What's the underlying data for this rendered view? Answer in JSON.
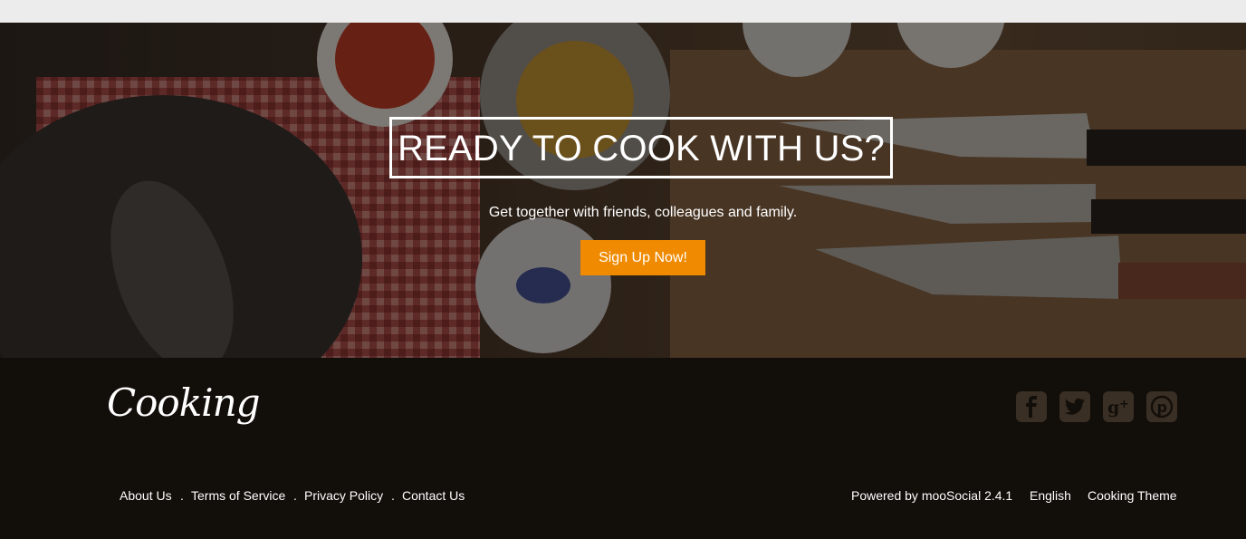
{
  "hero": {
    "title": "READY TO COOK WITH US?",
    "subtitle": "Get together with friends, colleagues and family.",
    "signup_label": "Sign Up Now!"
  },
  "footer": {
    "logo_text": "Cooking",
    "social": [
      {
        "icon": "facebook-icon",
        "glyph": "f"
      },
      {
        "icon": "twitter-icon",
        "glyph": "t"
      },
      {
        "icon": "google-plus-icon",
        "glyph": "g+"
      },
      {
        "icon": "pinterest-icon",
        "glyph": "p"
      }
    ],
    "links": [
      "About Us",
      "Terms of Service",
      "Privacy Policy",
      "Contact Us"
    ],
    "separator": ".",
    "powered_by": "Powered by mooSocial 2.4.1",
    "language": "English",
    "theme": "Cooking Theme"
  },
  "colors": {
    "accent": "#f08a00",
    "footer_bg": "#120e0a",
    "icon_bg": "#3a2f24"
  }
}
